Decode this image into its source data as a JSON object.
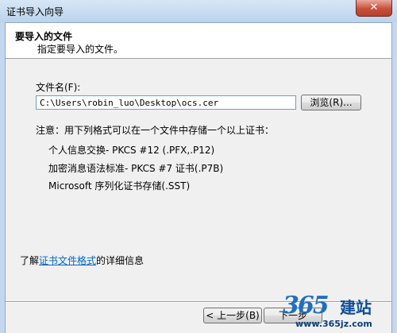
{
  "window": {
    "title": "证书导入向导",
    "close_label": "✕"
  },
  "header": {
    "title": "要导入的文件",
    "subtitle": "指定要导入的文件。"
  },
  "file": {
    "label": "文件名(F):",
    "value": "C:\\Users\\robin_luo\\Desktop\\ocs.cer",
    "browse_label": "浏览(R)..."
  },
  "note": {
    "intro": "注意：用下列格式可以在一个文件中存储一个以上证书：",
    "formats": [
      "个人信息交换- PKCS #12 (.PFX,.P12)",
      "加密消息语法标准- PKCS #7 证书(.P7B)",
      "Microsoft 序列化证书存储(.SST)"
    ]
  },
  "learn_more": {
    "prefix": "了解",
    "link": "证书文件格式",
    "suffix": "的详细信息"
  },
  "buttons": {
    "back": "< 上一步(B)",
    "next": "下一步"
  },
  "watermark": {
    "number": "365",
    "brand": "建站",
    "url": "www.365jz.com"
  }
}
